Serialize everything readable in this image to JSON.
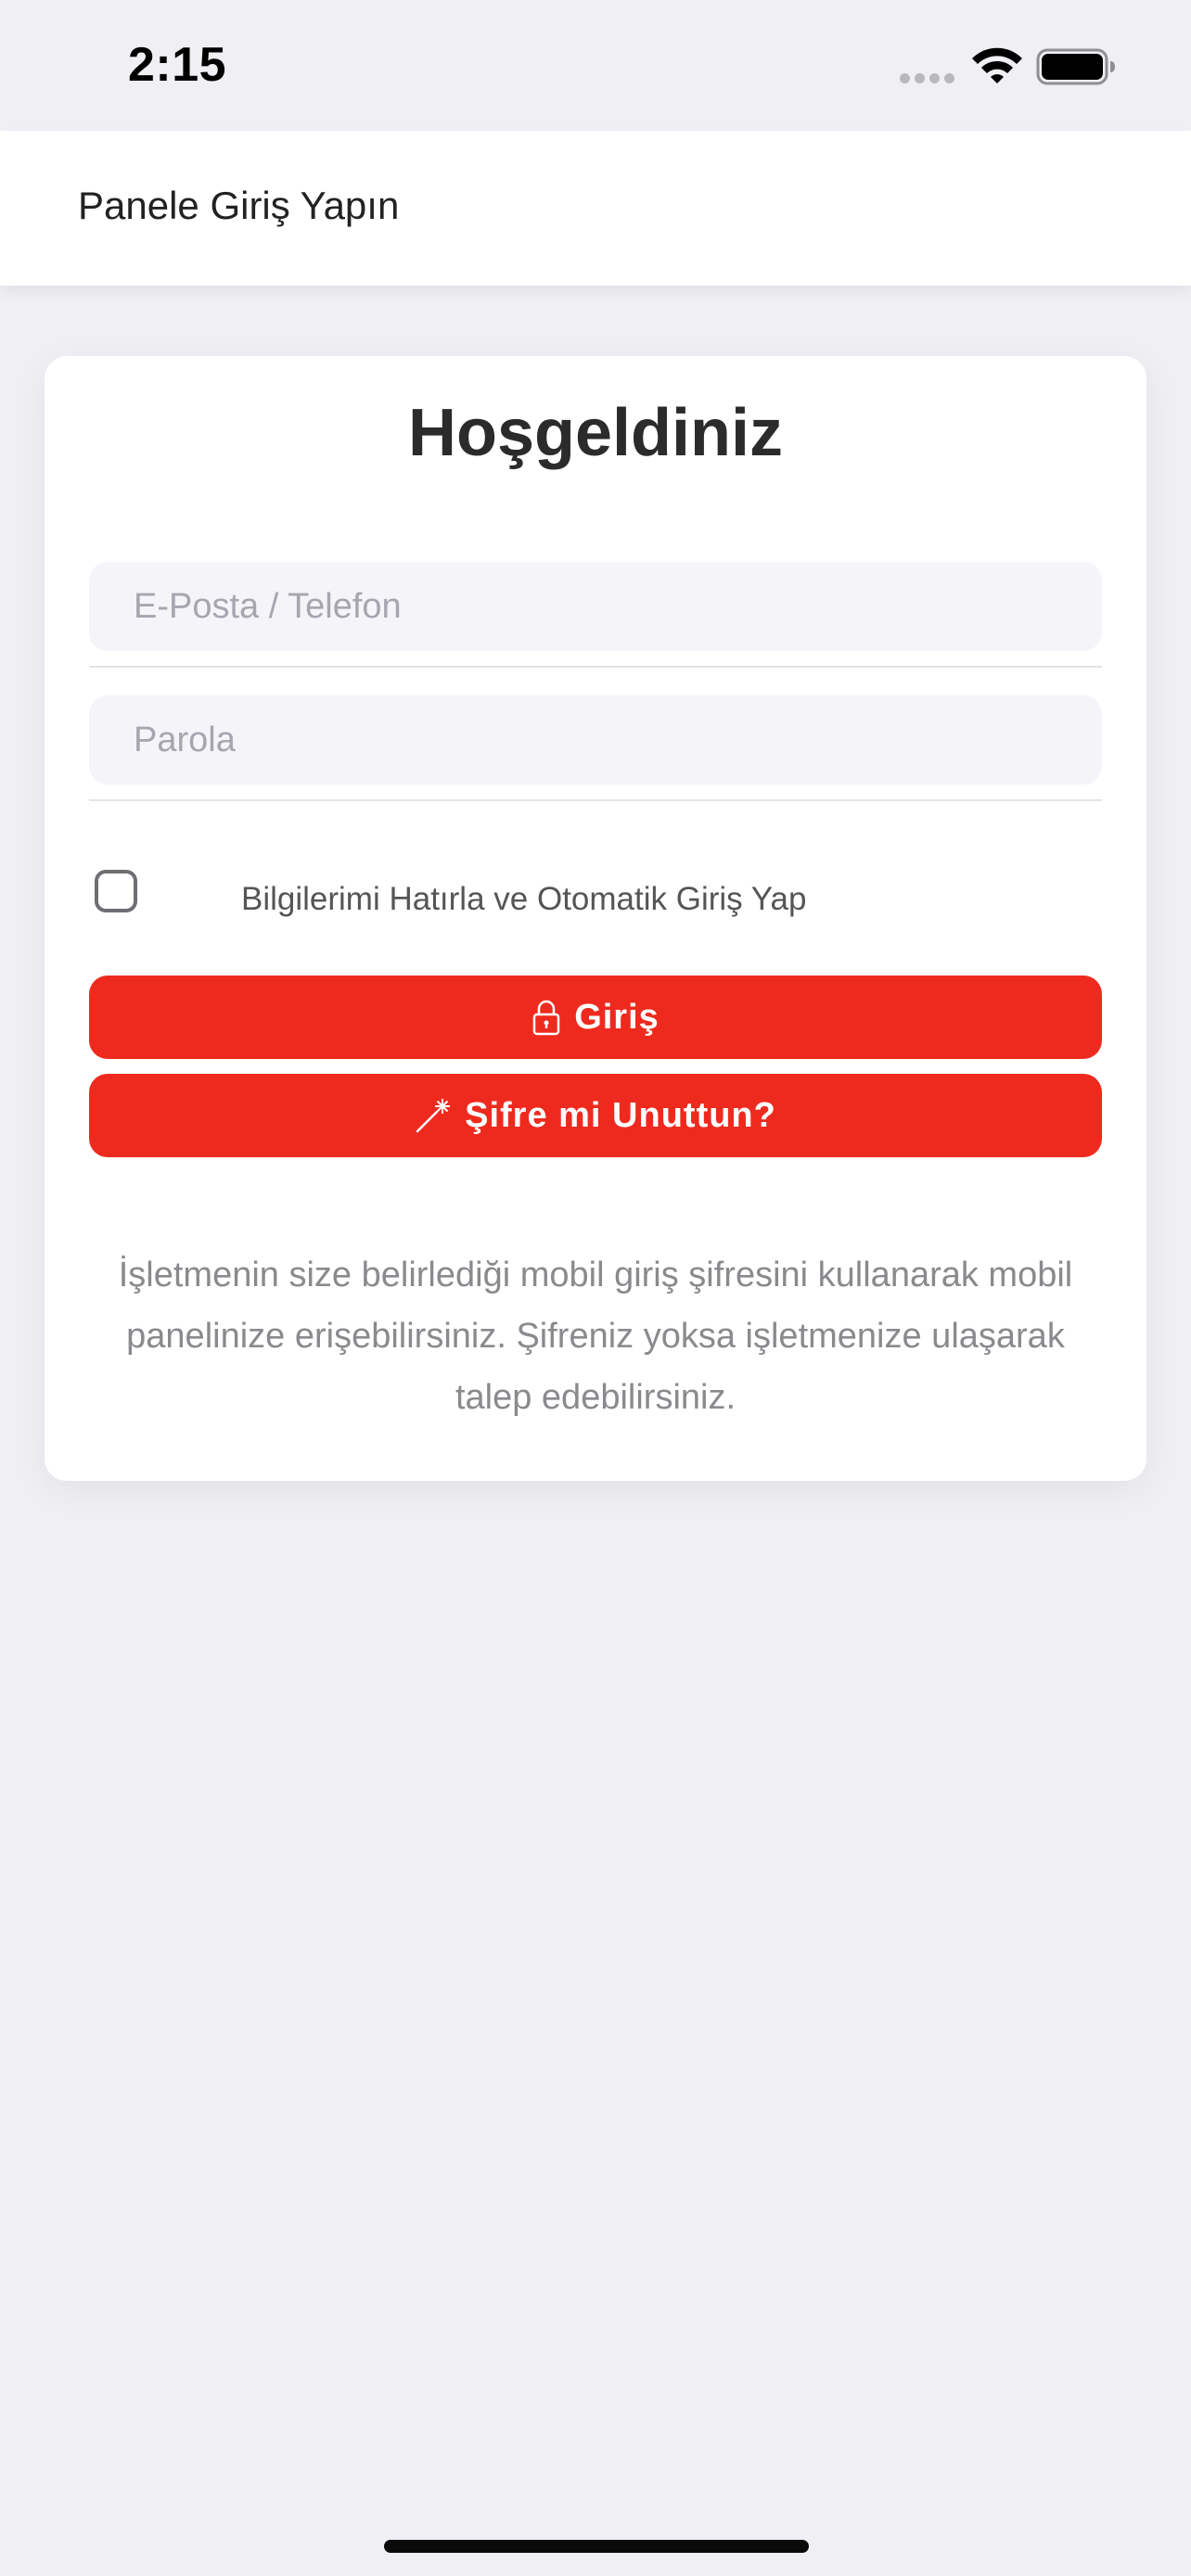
{
  "status_bar": {
    "time": "2:15"
  },
  "header": {
    "title": "Panele Giriş Yapın"
  },
  "card": {
    "title": "Hoşgeldiniz",
    "email_placeholder": "E-Posta / Telefon",
    "email_value": "",
    "password_placeholder": "Parola",
    "password_value": "",
    "remember_label": "Bilgilerimi Hatırla ve Otomatik Giriş Yap",
    "remember_checked": false,
    "login_button_label": "Giriş",
    "forgot_button_label": "Şifre mi Unuttun?",
    "info_text": "İşletmenin size belirlediği mobil giriş şifresini kullanarak mobil panelinize erişebilirsiniz. Şifreniz yoksa işletmenize ulaşarak talep edebilirsiniz."
  },
  "colors": {
    "accent": "#ee2a1e",
    "background": "#efeff4",
    "input_background": "#f4f4f9"
  },
  "icons": {
    "login_button": "lock-icon",
    "forgot_button": "magic-wand-icon",
    "status_wifi": "wifi-icon",
    "status_battery": "battery-icon",
    "status_signal": "signal-dots-icon"
  }
}
